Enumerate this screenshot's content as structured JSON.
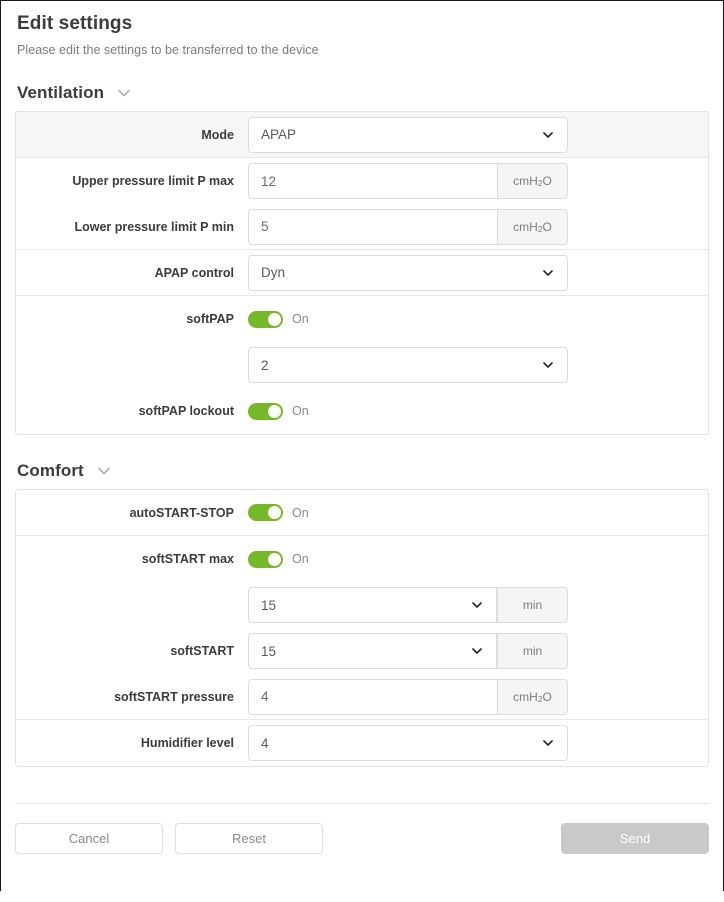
{
  "header": {
    "title": "Edit settings",
    "subtitle": "Please edit the settings to be transferred to the device"
  },
  "colors": {
    "toggle_on": "#76b828",
    "send_disabled": "#c9c9c9",
    "card_border": "#e3e3e3",
    "shaded_row": "#f6f6f6"
  },
  "sections": [
    {
      "title": "Ventilation",
      "collapse_icon": "chevron-down-icon",
      "rows": [
        {
          "label": "Mode",
          "control": "select",
          "value": "APAP",
          "caret_icon": "chevron-down-icon"
        },
        {
          "label": "Upper pressure limit P max",
          "control": "input-unit",
          "value": "12",
          "unit": "cmH",
          "unit_sub": "2",
          "unit_tail": "O"
        },
        {
          "label": "Lower pressure limit P min",
          "control": "input-unit",
          "value": "5",
          "unit": "cmH",
          "unit_sub": "2",
          "unit_tail": "O"
        },
        {
          "label": "APAP control",
          "control": "select",
          "value": "Dyn",
          "caret_icon": "chevron-down-icon"
        },
        {
          "label": "softPAP",
          "control": "toggle",
          "state": "On"
        },
        {
          "label": "",
          "control": "select",
          "value": "2",
          "caret_icon": "chevron-down-icon"
        },
        {
          "label": "softPAP lockout",
          "control": "toggle",
          "state": "On"
        }
      ]
    },
    {
      "title": "Comfort",
      "collapse_icon": "chevron-down-icon",
      "rows": [
        {
          "label": "autoSTART-STOP",
          "control": "toggle",
          "state": "On"
        },
        {
          "label": "softSTART max",
          "control": "toggle",
          "state": "On"
        },
        {
          "label": "",
          "control": "select-unit",
          "value": "15",
          "unit": "min",
          "caret_icon": "chevron-down-icon"
        },
        {
          "label": "softSTART",
          "control": "select-unit",
          "value": "15",
          "unit": "min",
          "caret_icon": "chevron-down-icon"
        },
        {
          "label": "softSTART pressure",
          "control": "input-unit",
          "value": "4",
          "unit": "cmH",
          "unit_sub": "2",
          "unit_tail": "O"
        },
        {
          "label": "Humidifier level",
          "control": "select",
          "value": "4",
          "caret_icon": "chevron-down-icon"
        }
      ]
    }
  ],
  "footer": {
    "cancel_label": "Cancel",
    "reset_label": "Reset",
    "send_label": "Send"
  }
}
